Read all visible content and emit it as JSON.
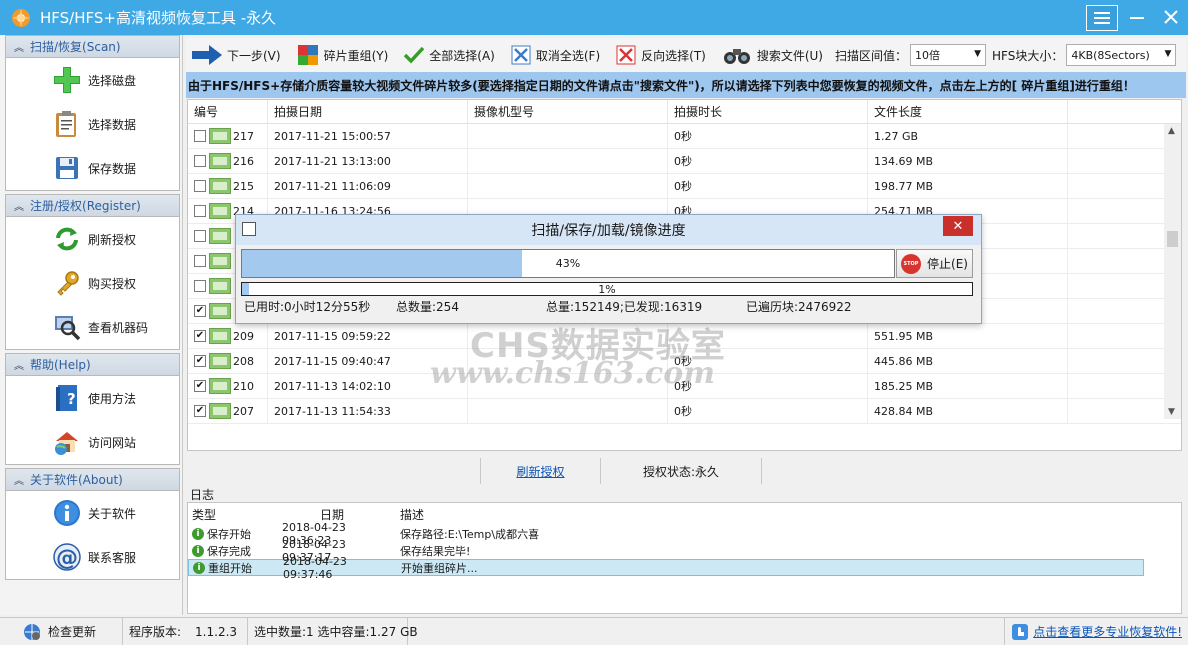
{
  "window": {
    "title": "HFS/HFS+高清视频恢复工具 -永久",
    "controls": [
      "menu-icon",
      "minimize-icon",
      "close-icon"
    ]
  },
  "sidebar": {
    "sections": [
      {
        "title": "扫描/恢复(Scan)",
        "items": [
          {
            "label": "选择磁盘",
            "icon": "plus-icon"
          },
          {
            "label": "选择数据",
            "icon": "clipboard-icon"
          },
          {
            "label": "保存数据",
            "icon": "floppy-disk-icon"
          }
        ]
      },
      {
        "title": "注册/授权(Register)",
        "items": [
          {
            "label": "刷新授权",
            "icon": "refresh-icon"
          },
          {
            "label": "购买授权",
            "icon": "key-icon"
          },
          {
            "label": "查看机器码",
            "icon": "magnifier-icon"
          }
        ]
      },
      {
        "title": "帮助(Help)",
        "items": [
          {
            "label": "使用方法",
            "icon": "help-book-icon"
          },
          {
            "label": "访问网站",
            "icon": "home-globe-icon"
          }
        ]
      },
      {
        "title": "关于软件(About)",
        "items": [
          {
            "label": "关于软件",
            "icon": "info-icon"
          },
          {
            "label": "联系客服",
            "icon": "at-sign-icon"
          }
        ]
      }
    ]
  },
  "toolbar": {
    "next": "下一步(V)",
    "reassemble": "碎片重组(Y)",
    "select_all": "全部选择(A)",
    "deselect_all": "取消全选(F)",
    "invert": "反向选择(T)",
    "search": "搜索文件(U)",
    "threshold_label": "扫描区间值：",
    "threshold_value": "10倍",
    "block_label": "HFS块大小：",
    "block_value": "4KB(8Sectors)"
  },
  "notice": "由于HFS/HFS+存储介质容量较大视频文件碎片较多(要选择指定日期的文件请点击\"搜索文件\")，所以请选择下列表中您要恢复的视频文件，点击左上方的[ 碎片重组]进行重组！",
  "table": {
    "headers": [
      "编号",
      "拍摄日期",
      "摄像机型号",
      "拍摄时长",
      "文件长度",
      ""
    ],
    "rows": [
      {
        "checked": false,
        "id": "217",
        "date": "2017-11-21 15:00:57",
        "model": "",
        "duration": "0秒",
        "size": "1.27 GB"
      },
      {
        "checked": false,
        "id": "216",
        "date": "2017-11-21 13:13:00",
        "model": "",
        "duration": "0秒",
        "size": "134.69 MB"
      },
      {
        "checked": false,
        "id": "215",
        "date": "2017-11-21 11:06:09",
        "model": "",
        "duration": "0秒",
        "size": "198.77 MB"
      },
      {
        "checked": false,
        "id": "214",
        "date": "2017-11-16 13:24:56",
        "model": "",
        "duration": "0秒",
        "size": "254.71 MB"
      },
      {
        "checked": false,
        "id": "",
        "date": "",
        "model": "",
        "duration": "",
        "size": ""
      },
      {
        "checked": false,
        "id": "",
        "date": "",
        "model": "",
        "duration": "",
        "size": ""
      },
      {
        "checked": false,
        "id": "",
        "date": "",
        "model": "",
        "duration": "",
        "size": ""
      },
      {
        "checked": true,
        "id": "",
        "date": "",
        "model": "",
        "duration": "",
        "size": ""
      },
      {
        "checked": true,
        "id": "209",
        "date": "2017-11-15 09:59:22",
        "model": "",
        "duration": "",
        "size": "551.95 MB"
      },
      {
        "checked": true,
        "id": "208",
        "date": "2017-11-15 09:40:47",
        "model": "",
        "duration": "0秒",
        "size": "445.86 MB"
      },
      {
        "checked": true,
        "id": "210",
        "date": "2017-11-13 14:02:10",
        "model": "",
        "duration": "0秒",
        "size": "185.25 MB"
      },
      {
        "checked": true,
        "id": "207",
        "date": "2017-11-13 11:54:33",
        "model": "",
        "duration": "0秒",
        "size": "428.84 MB"
      }
    ]
  },
  "watermark": {
    "line1": "CHS数据实验室",
    "line2": "www.chs163.com"
  },
  "dialog": {
    "title": "扫描/保存/加载/镜像进度",
    "progress_main": 0.43,
    "progress_main_text": "43%",
    "progress_sub": 0.01,
    "progress_sub_text": "1%",
    "stop_label": "停止(E)",
    "stop_icon_text": "STOP",
    "stats": {
      "elapsed": "已用时:0小时12分55秒",
      "total": "总数量:254",
      "found": "总量:152149;已发现:16319",
      "traversed": "已遍历块:2476922"
    }
  },
  "midbar": {
    "refresh_link": "刷新授权",
    "license_status": "授权状态:永久"
  },
  "log": {
    "label": "日志",
    "headers": [
      "类型",
      "日期",
      "描述"
    ],
    "rows": [
      {
        "type": "保存开始",
        "date": "2018-04-23 09:36:23",
        "desc": "保存路径:E:\\Temp\\成都六喜"
      },
      {
        "type": "保存完成",
        "date": "2018-04-23 09:37:17",
        "desc": "保存结果完毕!"
      },
      {
        "type": "重组开始",
        "date": "2018-04-23 09:37:46",
        "desc": "开始重组碎片..."
      }
    ]
  },
  "statusbar": {
    "update": "检查更新",
    "version_label": "程序版本:",
    "version": "1.1.2.3",
    "selection": "选中数量:1 选中容量:1.27 GB",
    "more_link": "点击查看更多专业恢复软件!"
  },
  "colors": {
    "titlebar": "#3fa9e6",
    "notice_bg": "#9ec7f0",
    "progress_fill": "#a4c9ef",
    "link": "#0b55b7"
  }
}
